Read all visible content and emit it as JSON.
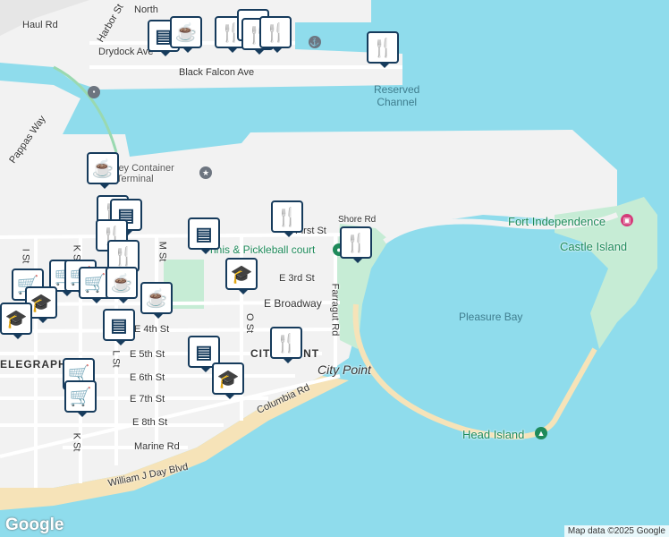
{
  "streets": {
    "haul_rd": "Haul Rd",
    "harbor_st": "Harbor St",
    "north": "North",
    "drydock_ave": "Drydock Ave",
    "black_falcon_ave": "Black Falcon Ave",
    "pappas_way": "Pappas Way",
    "shore_rd": "Shore Rd",
    "first_st": "First St",
    "m_st": "M St",
    "k_st": "K St",
    "l_st": "L St",
    "i_st": "I St",
    "e_3rd_st": "E 3rd St",
    "e_broadway": "E Broadway",
    "e_4th_st": "E 4th St",
    "e_5th_st": "E 5th St",
    "e_6th_st": "E 6th St",
    "e_7th_st": "E 7th St",
    "e_8th_st": "E 8th St",
    "marine_rd": "Marine Rd",
    "farragut_rd": "Farragut Rd",
    "o_st": "O St",
    "columbia_rd": "Columbia Rd",
    "william_j_day_blvd": "William J Day Blvd",
    "k_st_south": "K St"
  },
  "places": {
    "reserved_channel": "Reserved\nChannel",
    "container_terminal": "ley Container\nTerminal",
    "fort_independence": "Fort Independence",
    "castle_island": "Castle Island",
    "pleasure_bay": "Pleasure Bay",
    "head_island": "Head Island",
    "city_point": "City Point",
    "city_point_area": "CITY POINT",
    "telegraph": "ELEGRAPH",
    "tennis_court": "nnis & Pickleball court"
  },
  "attribution": {
    "logo": "Google",
    "copyright": "Map data ©2025 Google"
  },
  "pin_icons": {
    "shopping": "shopping-bag-icon",
    "cafe": "coffee-cup-icon",
    "restaurant": "fork-knife-icon",
    "school": "graduation-cap-icon",
    "grocery": "shopping-cart-icon"
  },
  "colors": {
    "water": "#8fdcec",
    "land": "#f2f2f2",
    "park": "#c6ecd5",
    "beach": "#f6e3b8",
    "pin_border": "#163b5c"
  }
}
